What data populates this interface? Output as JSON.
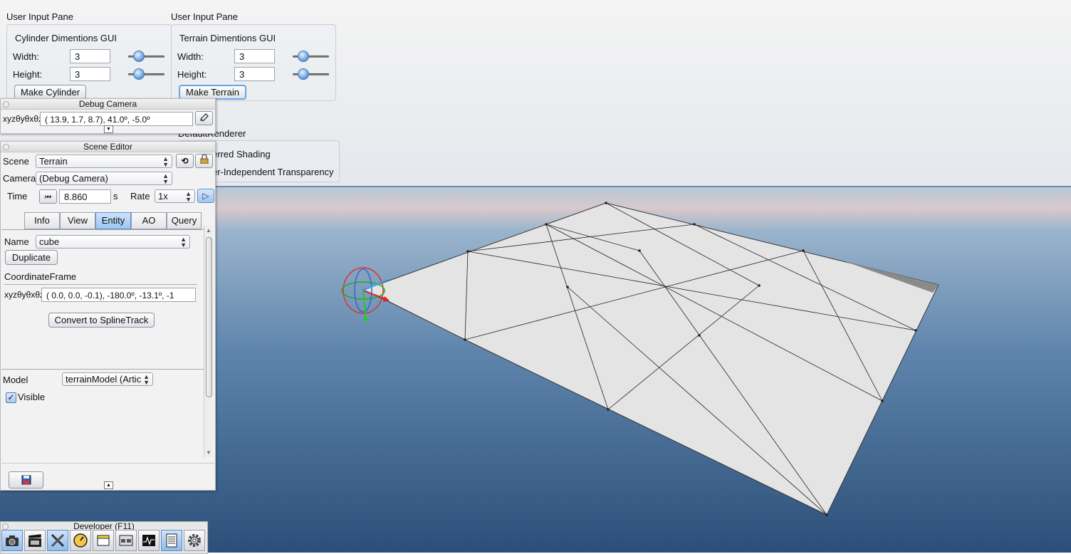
{
  "panes": {
    "cylinder": {
      "pane_title": "User Input Pane",
      "group_title": "Cylinder Dimentions GUI",
      "width_label": "Width:",
      "width_value": "3",
      "width_slider": 0.2,
      "height_label": "Height:",
      "height_value": "3",
      "height_slider": 0.2,
      "button": "Make Cylinder"
    },
    "terrain": {
      "pane_title": "User Input Pane",
      "group_title": "Terrain Dimentions GUI",
      "width_label": "Width:",
      "width_value": "3",
      "width_slider": 0.2,
      "height_label": "Height:",
      "height_value": "3",
      "height_slider": 0.2,
      "button": "Make Terrain"
    }
  },
  "renderer": {
    "title": "DefaultRenderer",
    "opt1": "erred Shading",
    "opt2": "er-Independent Transparency"
  },
  "debug_camera": {
    "title": "Debug Camera",
    "coord_label": "xyzθyθxθz",
    "coord_value": "( 13.9,   1.7,   8.7),  41.0º,  -5.0º"
  },
  "scene_editor": {
    "title": "Scene Editor",
    "scene_label": "Scene",
    "scene_value": "Terrain",
    "camera_label": "Camera",
    "camera_value": "(Debug Camera)",
    "time_label": "Time",
    "time_value": "8.860",
    "time_unit": "s",
    "rate_label": "Rate",
    "rate_value": "1x",
    "tabs": [
      "Info",
      "View",
      "Entity",
      "AO",
      "Query"
    ],
    "active_tab": "Entity",
    "name_label": "Name",
    "name_value": "cube",
    "duplicate_btn": "Duplicate",
    "frame_heading": "CoordinateFrame",
    "frame_label": "xyzθyθxθz",
    "frame_value": "(  0.0,   0.0,  -0.1), -180.0º, -13.1º, -1",
    "convert_btn": "Convert to SplineTrack",
    "model_label": "Model",
    "model_value": "terrainModel (Artic",
    "visible_label": "Visible",
    "visible_checked": true
  },
  "developer": {
    "title": "Developer (F11)",
    "icons": [
      "camera-icon",
      "film-icon",
      "tools-icon",
      "profiler-icon",
      "window-icon",
      "scene-icon",
      "graph-icon",
      "log-icon",
      "gear-icon"
    ],
    "active_icon": "log-icon"
  },
  "colors": {
    "sky_top": "#f3f3f3",
    "sky_bottom": "#e6e9ee",
    "sea_top": "#9bb6cf",
    "sea_bottom": "#2e5785",
    "terrain": "#e6e6e6",
    "accent": "#6aa6e6"
  }
}
